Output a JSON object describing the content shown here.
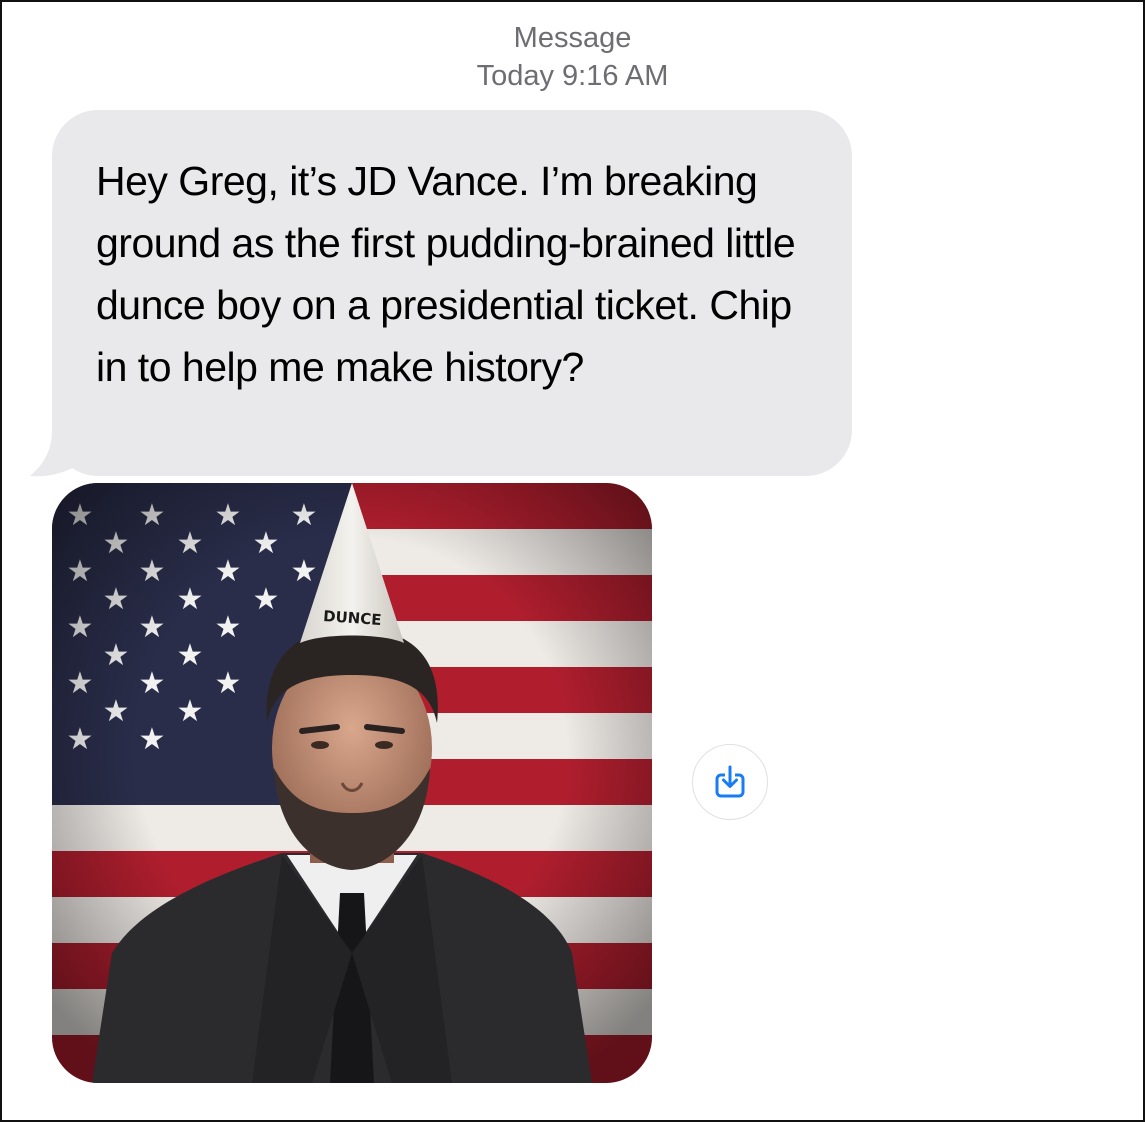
{
  "header": {
    "service": "Message",
    "timestamp": "Today 9:16 AM"
  },
  "message": {
    "text": "Hey Greg, it’s JD Vance. I’m breaking ground as the first pudding-brained little dunce boy on a presidential ticket. Chip in to help me make history?"
  },
  "attachment": {
    "hat_label": "DUNCE",
    "icon": "download-icon"
  },
  "colors": {
    "bubble": "#e9e9eb",
    "header_text": "#6d6d72",
    "accent": "#1a7cf5",
    "flag_red": "#b01e2e",
    "flag_blue": "#2a2d4a"
  }
}
